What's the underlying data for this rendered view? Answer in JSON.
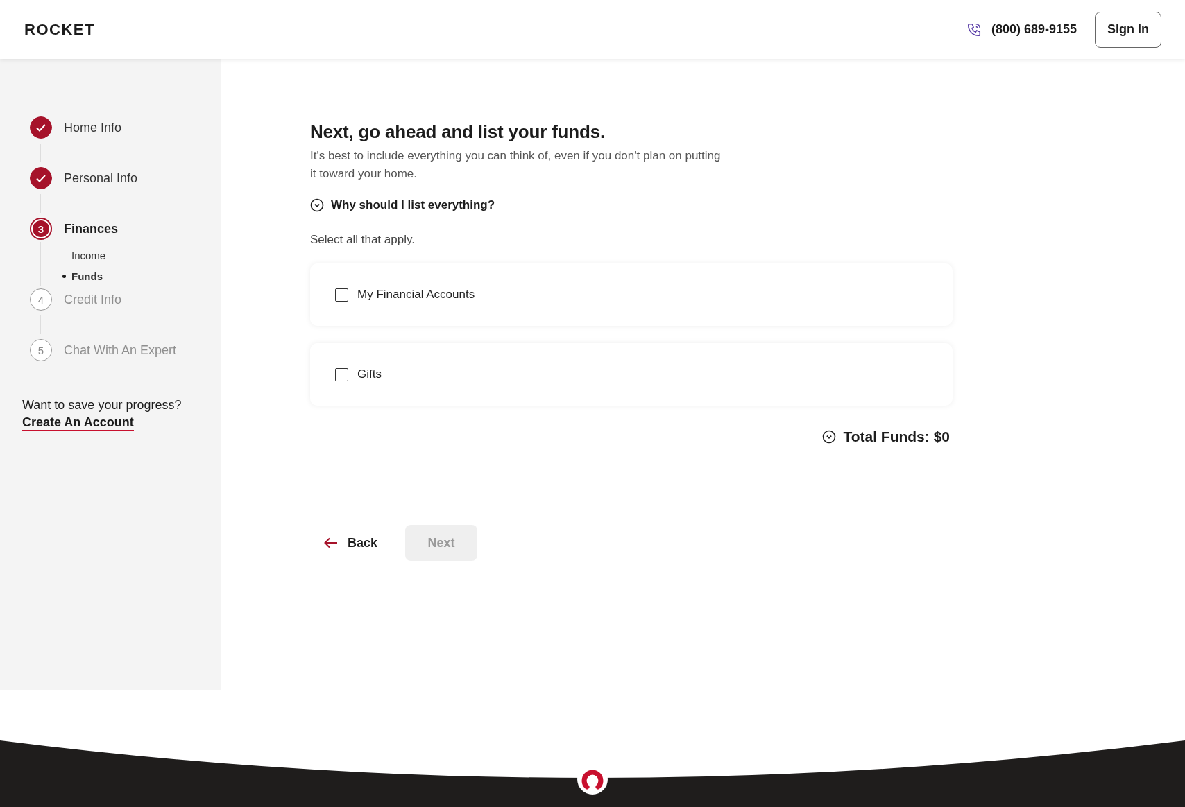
{
  "header": {
    "logo": "ROCKET",
    "phone": "(800) 689-9155",
    "sign_in": "Sign In"
  },
  "sidebar": {
    "steps": [
      {
        "label": "Home Info",
        "kind": "done"
      },
      {
        "label": "Personal Info",
        "kind": "done"
      },
      {
        "number": "3",
        "label": "Finances",
        "kind": "current",
        "children": [
          {
            "label": "Income",
            "selected": false
          },
          {
            "label": "Funds",
            "selected": true
          }
        ]
      },
      {
        "number": "4",
        "label": "Credit Info",
        "kind": "upcoming"
      },
      {
        "number": "5",
        "label": "Chat With An Expert",
        "kind": "upcoming"
      }
    ],
    "save_prompt": "Want to save your progress?",
    "save_link": "Create An Account"
  },
  "main": {
    "title": "Next, go ahead and list your funds.",
    "subtitle": "It's best to include everything you can think of, even if you don't plan on putting it toward your home.",
    "why": {
      "label": "Why should I list everything?",
      "expanded": false
    },
    "instruction": "Select all that apply.",
    "options": [
      {
        "label": "My Financial Accounts",
        "checked": false
      },
      {
        "label": "Gifts",
        "checked": false
      }
    ],
    "total": {
      "label": "Total Funds: $0",
      "expanded": false
    },
    "back": "Back",
    "next": {
      "label": "Next",
      "disabled": true
    }
  }
}
